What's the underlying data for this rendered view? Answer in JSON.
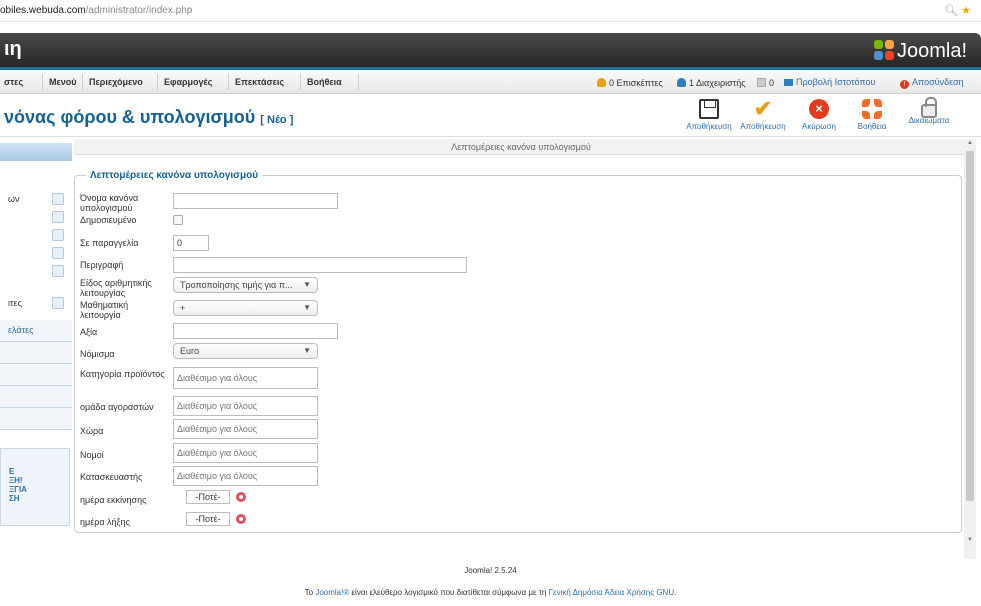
{
  "browser": {
    "url_domain": "obiles.webuda.com",
    "url_path": "/administrator/index.php",
    "zoom_icon": "zoom-icon",
    "star_icon": "star-icon"
  },
  "header": {
    "site_title": "ιη",
    "logo_text": "Joomla!"
  },
  "menu": {
    "items": [
      "στες",
      "Μενού",
      "Περιεχόμενο",
      "Εφαρμογές",
      "Επεκτάσεις",
      "Βοήθεια"
    ],
    "status": {
      "visitors": "0 Επισκέπτες",
      "admins": "1 Διαχειριστής",
      "messages": "0",
      "view_site": "Προβολή Ιστοτόπου",
      "logout": "Αποσύνδεση"
    }
  },
  "toolbar": {
    "title": "νόνας φόρου & υπολογισμού",
    "title_badge": "[ Νέο ]",
    "buttons": {
      "save": "Αποθήκευση",
      "save_close": "Αποθήκευση",
      "cancel": "Ακύρωση",
      "help": "Βοήθεια",
      "permissions": "Δικαιώματα"
    }
  },
  "sidebar": {
    "rows": [
      "ων",
      "",
      "",
      "",
      "",
      "ιτες"
    ],
    "section": "ελάτες",
    "box_lines": [
      "E",
      "ΞΗ!",
      "ΞΓΙΑ",
      "ΣΗ"
    ]
  },
  "content": {
    "header": "Λεπτομέρειες κανόνα υπολογισμού",
    "legend": "Λεπτομέρειες κανόνα υπολογισμού"
  },
  "form": {
    "rule_name_label": "Όνομα κανόνα υπολογισμού",
    "rule_name_value": "",
    "published_label": "Δημοσιευμένο",
    "published_checked": false,
    "ordering_label": "Σε παραγγελία",
    "ordering_value": "0",
    "description_label": "Περιγραφή",
    "description_value": "",
    "op_type_label": "Είδος αριθμητικής λειτουργίας",
    "op_type_value": "Τροποποίησης τιμής για π...",
    "math_op_label": "Μαθηματική λειτουργία",
    "math_op_value": "+",
    "value_label": "Αξία",
    "value_value": "",
    "currency_label": "Νόμισμα",
    "currency_value": "Euro",
    "category_label": "Κατηγορία προϊόντος",
    "category_placeholder": "Διαθέσιμο για όλους",
    "shopper_label": "ομάδα αγοραστών",
    "shopper_placeholder": "Διαθέσιμο για όλους",
    "country_label": "Χώρα",
    "country_placeholder": "Διαθέσιμο για όλους",
    "state_label": "Νομοί",
    "state_placeholder": "Διαθέσιμο για όλους",
    "manufacturer_label": "Κατασκευαστής",
    "manufacturer_placeholder": "Διαθέσιμο για όλους",
    "start_label": "ημέρα εκκίνησης",
    "start_value": "-Ποτέ-",
    "end_label": "ημέρα λήξης",
    "end_value": "-Ποτέ-"
  },
  "footer": {
    "version": "Joomla! 2.5.24",
    "license_prefix": "Το",
    "license_link1": "Joomla!®",
    "license_mid": "είναι ελεύθερο λογισμικό που διατίθεται σύμφωνα με τη",
    "license_link2": "Γενική Δημόσια Άδεια Χρήσης GNU",
    "license_suffix": "."
  },
  "colors": {
    "accent_blue": "#146295",
    "header_dark": "#262626",
    "cancel_red": "#e23b1c",
    "check_orange": "#f29a18"
  }
}
